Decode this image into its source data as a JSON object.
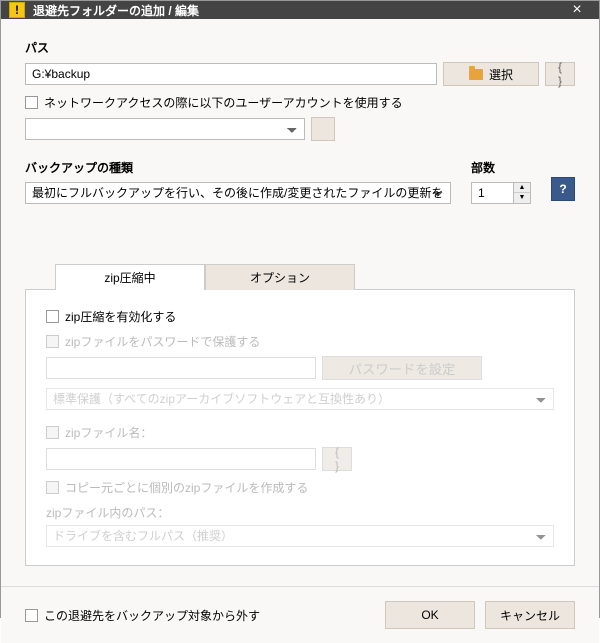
{
  "titlebar": {
    "icon_char": "!",
    "title": "退避先フォルダーの追加 / 編集",
    "close": "×"
  },
  "path": {
    "label": "パス",
    "value": "G:¥backup",
    "select_btn": "選択",
    "curly": "{ }",
    "network_checkbox": "ネットワークアクセスの際に以下のユーザーアカウントを使用する"
  },
  "backup": {
    "label": "バックアップの種類",
    "selected": "最初にフルバックアップを行い、その後に作成/変更されたファイルの更新を行う",
    "copies_label": "部数",
    "copies_value": "1",
    "help": "?"
  },
  "tabs": {
    "zip": "zip圧縮中",
    "options": "オプション"
  },
  "zip": {
    "enable": "zip圧縮を有効化する",
    "protect_pwd": "zipファイルをパスワードで保護する",
    "set_pwd_btn": "パスワードを設定",
    "protection_selected": "標準保護（すべてのzipアーカイブソフトウェアと互換性あり）",
    "zip_filename_label": "zipファイル名：",
    "curly": "{ }",
    "separate_files": "コピー元ごとに個別のzipファイルを作成する",
    "zip_path_label": "zipファイル内のパス：",
    "zip_path_selected": "ドライブを含むフルパス（推奨）"
  },
  "footer": {
    "exclude": "この退避先をバックアップ対象から外す",
    "ok": "OK",
    "cancel": "キャンセル"
  }
}
